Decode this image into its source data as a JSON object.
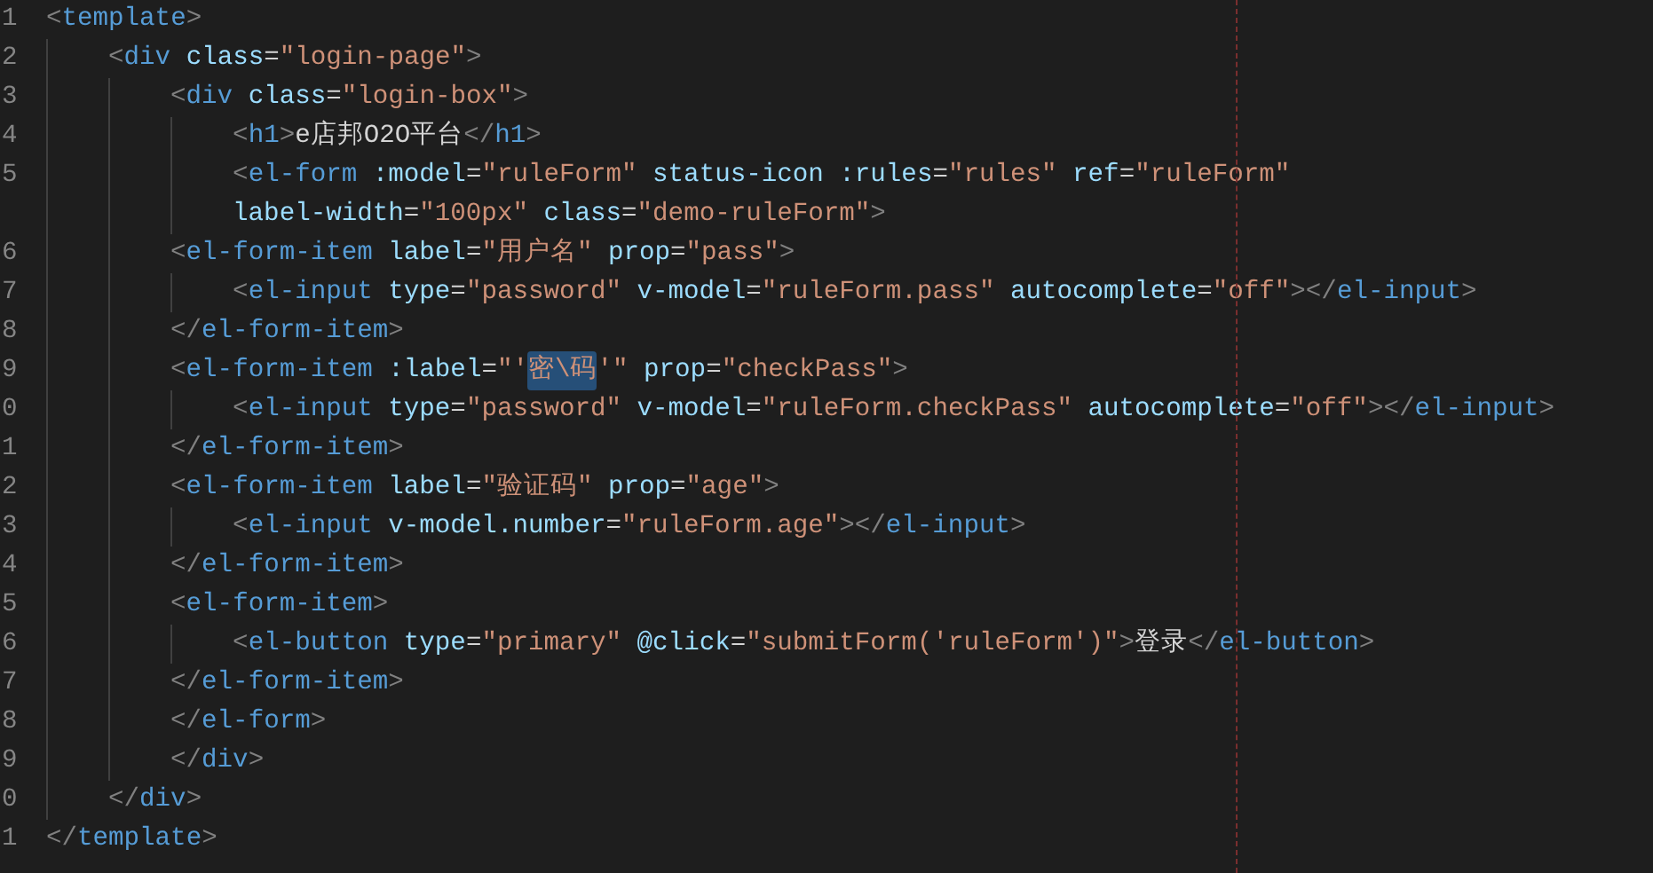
{
  "editor": {
    "lines": [
      {
        "number": "1",
        "parts": [
          {
            "text": "<template>",
            "selected": false
          }
        ]
      },
      {
        "number": "2",
        "parts": [
          {
            "text": "    <div class=\"login-page\">",
            "selected": false
          }
        ]
      },
      {
        "number": "3",
        "parts": [
          {
            "text": "        <div class=\"login-box\">",
            "selected": false
          }
        ]
      },
      {
        "number": "4",
        "parts": [
          {
            "text": "            <h1>e店邦O2O平台</h1>",
            "selected": false
          }
        ]
      },
      {
        "number": "5",
        "parts": [
          {
            "text": "            <el-form :model=\"ruleForm\" status-icon :rules=\"rules\" ref=\"ruleForm\"",
            "selected": false
          }
        ]
      },
      {
        "parts": [
          {
            "text": "            label-width=\"100px\" class=\"demo-ruleForm\">",
            "selected": false
          }
        ]
      },
      {
        "number": "6",
        "parts": [
          {
            "text": "        <el-form-item label=\"用户名\" prop=\"pass\">",
            "selected": false
          }
        ]
      },
      {
        "number": "7",
        "parts": [
          {
            "text": "            <el-input type=\"password\" v-model=\"ruleForm.pass\" autocomplete=\"off\"></el-input>",
            "selected": false
          }
        ]
      },
      {
        "number": "8",
        "parts": [
          {
            "text": "        </el-form-item>",
            "selected": false
          }
        ]
      },
      {
        "number": "9",
        "parts": [
          {
            "text": "        <el-form-item :label=\"'",
            "selected": false
          },
          {
            "text": "密\\码",
            "selected": true
          },
          {
            "text": "'\" prop=\"checkPass\">",
            "selected": false
          }
        ]
      },
      {
        "number": "0",
        "parts": [
          {
            "text": "            <el-input type=\"password\" v-model=\"ruleForm.checkPass\" autocomplete=\"off\"></el-input>",
            "selected": false
          }
        ]
      },
      {
        "number": "1",
        "parts": [
          {
            "text": "        </el-form-item>",
            "selected": false
          }
        ]
      },
      {
        "number": "2",
        "parts": [
          {
            "text": "        <el-form-item label=\"验证码\" prop=\"age\">",
            "selected": false
          }
        ]
      },
      {
        "number": "3",
        "parts": [
          {
            "text": "            <el-input v-model.number=\"ruleForm.age\"></el-input>",
            "selected": false
          }
        ]
      },
      {
        "number": "4",
        "parts": [
          {
            "text": "        </el-form-item>",
            "selected": false
          }
        ]
      },
      {
        "number": "5",
        "parts": [
          {
            "text": "        <el-form-item>",
            "selected": false
          }
        ]
      },
      {
        "number": "6",
        "parts": [
          {
            "text": "            <el-button type=\"primary\" @click=\"submitForm('ruleForm')\">登录</el-button>",
            "selected": false
          }
        ]
      },
      {
        "number": "7",
        "parts": [
          {
            "text": "        </el-form-item>",
            "selected": false
          }
        ]
      },
      {
        "number": "8",
        "parts": [
          {
            "text": "        </el-form>",
            "selected": false
          }
        ]
      },
      {
        "number": "9",
        "parts": [
          {
            "text": "        </div>",
            "selected": false
          }
        ]
      },
      {
        "number": "0",
        "parts": [
          {
            "text": "    </div>",
            "selected": false
          }
        ]
      },
      {
        "number": "1",
        "parts": [
          {
            "text": "</template>",
            "selected": false
          }
        ]
      }
    ]
  }
}
